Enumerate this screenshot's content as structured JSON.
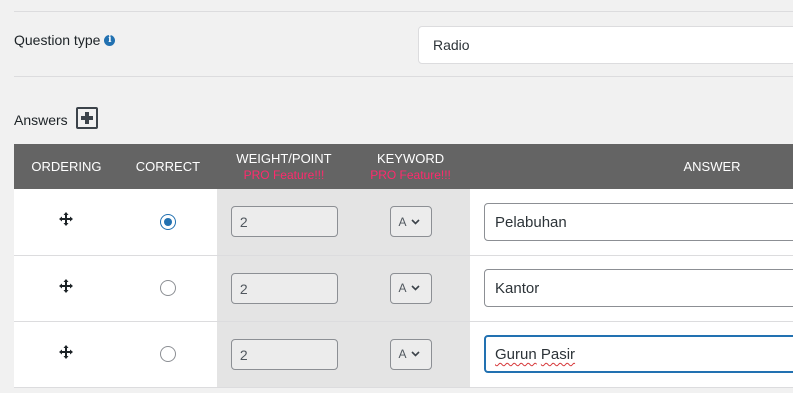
{
  "question_type": {
    "label": "Question type",
    "info_icon": "info-icon",
    "selected": "Radio"
  },
  "answers": {
    "label": "Answers",
    "add_icon": "plus-square-icon"
  },
  "table": {
    "headers": {
      "ordering": "ORDERING",
      "correct": "CORRECT",
      "weight": "WEIGHT/POINT",
      "weight_pro": "PRO Feature!!!",
      "keyword": "KEYWORD",
      "keyword_pro": "PRO Feature!!!",
      "answer": "ANSWER"
    },
    "rows": [
      {
        "correct": true,
        "weight": "2",
        "keyword": "A",
        "answer_word1": "Pelabuhan",
        "answer_word2": ""
      },
      {
        "correct": false,
        "weight": "2",
        "keyword": "A",
        "answer_word1": "Kantor",
        "answer_word2": ""
      },
      {
        "correct": false,
        "weight": "2",
        "keyword": "A",
        "answer_word1": "Gurun",
        "answer_word2": "Pasir"
      }
    ]
  },
  "colors": {
    "header_bg": "#646464",
    "pro_text": "#ff2a6d",
    "accent": "#2271b1"
  }
}
